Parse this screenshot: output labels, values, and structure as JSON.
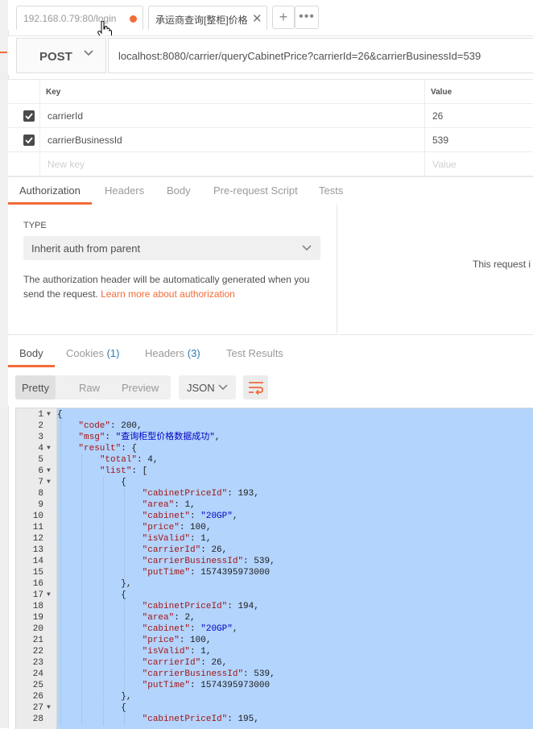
{
  "tabs": [
    {
      "label": "192.168.0.79:80/login",
      "unsaved": true
    },
    {
      "label": "承运商查询[整柜]价格",
      "closable": true
    }
  ],
  "tabbar": {
    "add_icon": "+",
    "more_icon": "•••"
  },
  "request": {
    "method": "POST",
    "url": "localhost:8080/carrier/queryCabinetPrice?carrierId=26&carrierBusinessId=539"
  },
  "params": {
    "headers": {
      "key": "Key",
      "value": "Value"
    },
    "rows": [
      {
        "checked": true,
        "key": "carrierId",
        "value": "26"
      },
      {
        "checked": true,
        "key": "carrierBusinessId",
        "value": "539"
      }
    ],
    "new_key_placeholder": "New key",
    "new_value_placeholder": "Value"
  },
  "request_tabs": [
    {
      "label": "Authorization",
      "active": true
    },
    {
      "label": "Headers",
      "active": false
    },
    {
      "label": "Body",
      "active": false
    },
    {
      "label": "Pre-request Script",
      "active": false
    },
    {
      "label": "Tests",
      "active": false
    }
  ],
  "auth": {
    "type_label": "TYPE",
    "selected_type": "Inherit auth from parent",
    "description": "The authorization header will be automatically generated when you send the request.",
    "link": "Learn more about authorization",
    "right_note": "This request i"
  },
  "response_tabs": [
    {
      "label": "Body",
      "count": "",
      "active": true
    },
    {
      "label": "Cookies",
      "count": "(1)",
      "active": false
    },
    {
      "label": "Headers",
      "count": "(3)",
      "active": false
    },
    {
      "label": "Test Results",
      "count": "",
      "active": false
    }
  ],
  "response_toolbar": {
    "views": [
      "Pretty",
      "Raw",
      "Preview"
    ],
    "active_view": "Pretty",
    "format": "JSON"
  },
  "response_lines": [
    {
      "n": "1",
      "fold": true,
      "indent": 0,
      "text": "{"
    },
    {
      "n": "2",
      "indent": 1,
      "k": "\"code\"",
      "v": "200",
      "t": "num",
      "c": ","
    },
    {
      "n": "3",
      "indent": 1,
      "k": "\"msg\"",
      "v": "\"查询柜型价格数据成功\"",
      "t": "str",
      "c": ","
    },
    {
      "n": "4",
      "fold": true,
      "indent": 1,
      "k": "\"result\"",
      "v": "{",
      "t": "p",
      "c": ""
    },
    {
      "n": "5",
      "indent": 2,
      "k": "\"total\"",
      "v": "4",
      "t": "num",
      "c": ","
    },
    {
      "n": "6",
      "fold": true,
      "indent": 2,
      "k": "\"list\"",
      "v": "[",
      "t": "p",
      "c": ""
    },
    {
      "n": "7",
      "fold": true,
      "indent": 3,
      "text": "{"
    },
    {
      "n": "8",
      "indent": 4,
      "k": "\"cabinetPriceId\"",
      "v": "193",
      "t": "num",
      "c": ","
    },
    {
      "n": "9",
      "indent": 4,
      "k": "\"area\"",
      "v": "1",
      "t": "num",
      "c": ","
    },
    {
      "n": "10",
      "indent": 4,
      "k": "\"cabinet\"",
      "v": "\"20GP\"",
      "t": "str",
      "c": ","
    },
    {
      "n": "11",
      "indent": 4,
      "k": "\"price\"",
      "v": "100",
      "t": "num",
      "c": ","
    },
    {
      "n": "12",
      "indent": 4,
      "k": "\"isValid\"",
      "v": "1",
      "t": "num",
      "c": ","
    },
    {
      "n": "13",
      "indent": 4,
      "k": "\"carrierId\"",
      "v": "26",
      "t": "num",
      "c": ","
    },
    {
      "n": "14",
      "indent": 4,
      "k": "\"carrierBusinessId\"",
      "v": "539",
      "t": "num",
      "c": ","
    },
    {
      "n": "15",
      "indent": 4,
      "k": "\"putTime\"",
      "v": "1574395973000",
      "t": "num",
      "c": ""
    },
    {
      "n": "16",
      "indent": 3,
      "text": "},"
    },
    {
      "n": "17",
      "fold": true,
      "indent": 3,
      "text": "{"
    },
    {
      "n": "18",
      "indent": 4,
      "k": "\"cabinetPriceId\"",
      "v": "194",
      "t": "num",
      "c": ","
    },
    {
      "n": "19",
      "indent": 4,
      "k": "\"area\"",
      "v": "2",
      "t": "num",
      "c": ","
    },
    {
      "n": "20",
      "indent": 4,
      "k": "\"cabinet\"",
      "v": "\"20GP\"",
      "t": "str",
      "c": ","
    },
    {
      "n": "21",
      "indent": 4,
      "k": "\"price\"",
      "v": "100",
      "t": "num",
      "c": ","
    },
    {
      "n": "22",
      "indent": 4,
      "k": "\"isValid\"",
      "v": "1",
      "t": "num",
      "c": ","
    },
    {
      "n": "23",
      "indent": 4,
      "k": "\"carrierId\"",
      "v": "26",
      "t": "num",
      "c": ","
    },
    {
      "n": "24",
      "indent": 4,
      "k": "\"carrierBusinessId\"",
      "v": "539",
      "t": "num",
      "c": ","
    },
    {
      "n": "25",
      "indent": 4,
      "k": "\"putTime\"",
      "v": "1574395973000",
      "t": "num",
      "c": ""
    },
    {
      "n": "26",
      "indent": 3,
      "text": "},"
    },
    {
      "n": "27",
      "fold": true,
      "indent": 3,
      "text": "{"
    },
    {
      "n": "28",
      "indent": 4,
      "k": "\"cabinetPriceId\"",
      "v": "195",
      "t": "num",
      "c": ","
    }
  ],
  "colors": {
    "accent": "#f26b3a",
    "selection": "#b3d4fc",
    "link": "#f26b3a",
    "count": "#2a7ab5",
    "json_key": "#a31515",
    "json_string": "#0000c0"
  }
}
